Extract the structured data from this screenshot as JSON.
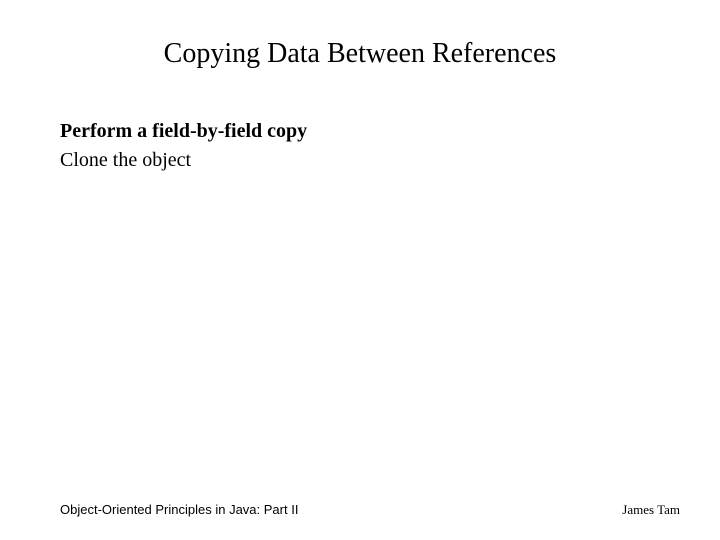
{
  "slide": {
    "title": "Copying Data Between References",
    "body": {
      "line1": "Perform a field-by-field copy",
      "line2": "Clone the object"
    },
    "footer": {
      "left": "Object-Oriented Principles in Java: Part II",
      "right": "James Tam"
    }
  }
}
